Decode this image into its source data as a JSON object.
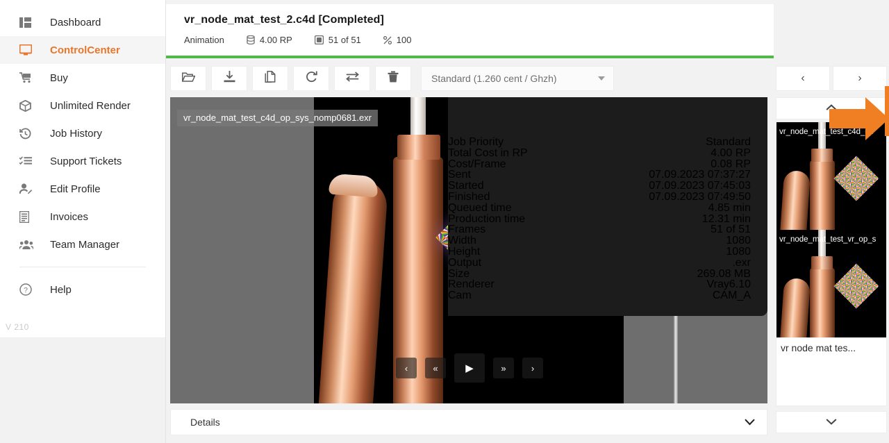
{
  "sidebar": {
    "items": [
      {
        "label": "Dashboard",
        "icon": "dashboard-icon",
        "active": false
      },
      {
        "label": "ControlCenter",
        "icon": "monitor-icon",
        "active": true
      },
      {
        "label": "Buy",
        "icon": "cart-icon",
        "active": false
      },
      {
        "label": "Unlimited Render",
        "icon": "box-icon",
        "active": false
      },
      {
        "label": "Job History",
        "icon": "history-icon",
        "active": false
      },
      {
        "label": "Support Tickets",
        "icon": "list-icon",
        "active": false
      },
      {
        "label": "Edit Profile",
        "icon": "user-edit-icon",
        "active": false
      },
      {
        "label": "Invoices",
        "icon": "invoice-icon",
        "active": false
      },
      {
        "label": "Team Manager",
        "icon": "team-icon",
        "active": false
      }
    ],
    "help": {
      "label": "Help",
      "icon": "question-circle-icon"
    },
    "version": "V 210"
  },
  "header": {
    "title": "vr_node_mat_test_2.c4d [Completed]",
    "meta": [
      {
        "icon": "",
        "label": "Animation"
      },
      {
        "icon": "coins-icon",
        "label": "4.00 RP"
      },
      {
        "icon": "frames-icon",
        "label": "51 of 51"
      },
      {
        "icon": "percent-icon",
        "label": "100"
      }
    ],
    "progress_color": "#53b84b",
    "collapse_icon": "collapse-panel-icon"
  },
  "toolbar": {
    "buttons": [
      {
        "name": "open-folder-button",
        "icon": "folder-open-icon"
      },
      {
        "name": "download-button",
        "icon": "download-icon"
      },
      {
        "name": "copy-button",
        "icon": "copy-icon"
      },
      {
        "name": "restart-button",
        "icon": "refresh-icon"
      },
      {
        "name": "transfer-button",
        "icon": "transfer-icon"
      },
      {
        "name": "delete-button",
        "icon": "trash-icon"
      }
    ],
    "select_value": "Standard (1.260 cent / Ghzh)",
    "account_icon": "account-user-icon"
  },
  "viewer": {
    "file_label": "vr_node_mat_test_c4d_op_sys_nomp0681.exr",
    "info_button_icon": "info-icon",
    "info_rows": [
      {
        "key": "Job Priority",
        "value": "Standard"
      },
      {
        "key": "Total Cost in RP",
        "value": "4.00 RP"
      },
      {
        "key": "Cost/Frame",
        "value": "0.08 RP"
      },
      {
        "key": "Sent",
        "value": "07.09.2023 07:37:27"
      },
      {
        "key": "Started",
        "value": "07.09.2023 07:45:03"
      },
      {
        "key": "Finished",
        "value": "07.09.2023 07:49:50"
      },
      {
        "key": "Queued time",
        "value": "4.85 min"
      },
      {
        "key": "Production time",
        "value": "12.31 min"
      },
      {
        "key": "Frames",
        "value": "51 of 51"
      },
      {
        "key": "Width",
        "value": "1080"
      },
      {
        "key": "Height",
        "value": "1080"
      },
      {
        "key": "Output",
        "value": ".exr"
      },
      {
        "key": "Size",
        "value": "269.08 MB"
      },
      {
        "key": "Renderer",
        "value": "Vray6.10"
      },
      {
        "key": "Cam",
        "value": "CAM_A"
      }
    ],
    "player": [
      {
        "name": "prev-frame-button",
        "glyph": "‹"
      },
      {
        "name": "rewind-button",
        "glyph": "«"
      },
      {
        "name": "play-button",
        "glyph": "▶"
      },
      {
        "name": "fast-forward-button",
        "glyph": "»"
      },
      {
        "name": "next-frame-button",
        "glyph": "›"
      }
    ]
  },
  "details": {
    "label": "Details",
    "chevron": "chevron-down-icon"
  },
  "right_panel": {
    "prev_label": "‹",
    "next_label": "›",
    "scroll_up_icon": "chevron-up-icon",
    "scroll_down_icon": "chevron-down-icon",
    "thumbnails": [
      {
        "label": "vr_node_mat_test_c4d_op"
      },
      {
        "label": "vr_node_mat_test_vr_op_s"
      }
    ],
    "caption": "vr  node  mat  tes..."
  },
  "annotation": {
    "highlight_color": "#ef7f22",
    "target": "info-icon-button"
  },
  "colors": {
    "accent": "#e8762c",
    "progress_green": "#53b84b",
    "annotation_orange": "#ef7f22",
    "viewer_gray": "#6e6e6e",
    "overlay_black": "#1c1c1c"
  }
}
